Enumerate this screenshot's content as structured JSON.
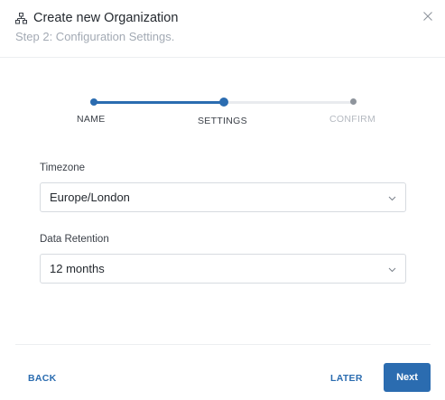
{
  "dialog": {
    "title": "Create new Organization",
    "subtitle": "Step 2: Configuration Settings.",
    "title_icon": "organization-icon",
    "close_icon": "close-icon"
  },
  "stepper": {
    "steps": [
      {
        "label": "NAME",
        "state": "completed"
      },
      {
        "label": "SETTINGS",
        "state": "active"
      },
      {
        "label": "CONFIRM",
        "state": "pending"
      }
    ],
    "current_step": 2,
    "total_steps": 3
  },
  "form": {
    "timezone": {
      "label": "Timezone",
      "value": "Europe/London"
    },
    "data_retention": {
      "label": "Data Retention",
      "value": "12 months"
    }
  },
  "footer": {
    "back_label": "BACK",
    "later_label": "LATER",
    "next_label": "Next"
  },
  "colors": {
    "accent": "#2b6cb0",
    "muted_text": "#a3aab4",
    "pending_step": "#8e949c"
  }
}
